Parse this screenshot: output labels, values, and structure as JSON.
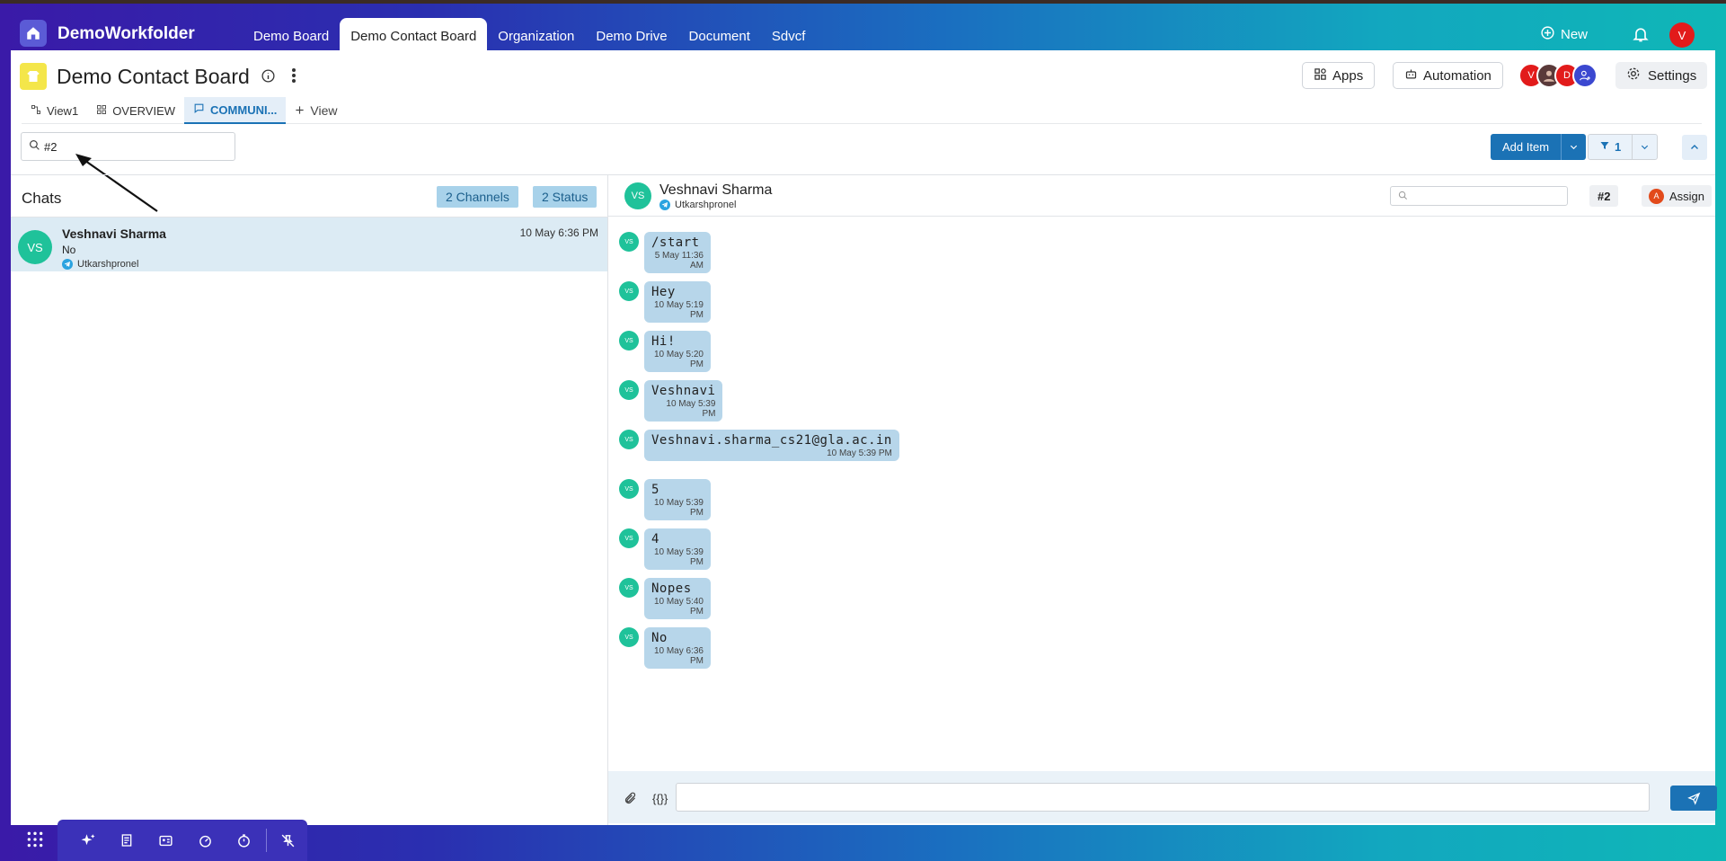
{
  "app": {
    "brand": "DemoWorkfolder",
    "nav_tabs": [
      "Demo Board",
      "Demo Contact Board",
      "Organization",
      "Demo Drive",
      "Document",
      "Sdvcf"
    ],
    "active_tab_index": 1,
    "new_label": "New",
    "user_initial": "V"
  },
  "board": {
    "title": "Demo Contact Board",
    "apps_label": "Apps",
    "automation_label": "Automation",
    "settings_label": "Settings",
    "member_initials": [
      "V",
      "",
      "D",
      ""
    ],
    "views": [
      "View1",
      "OVERVIEW",
      "COMMUNI...",
      "View"
    ],
    "active_view_index": 2
  },
  "toolbar": {
    "search_value": "#2",
    "add_item_label": "Add Item",
    "filter_count": "1"
  },
  "chats": {
    "title": "Chats",
    "channels_chip": "2 Channels",
    "status_chip": "2 Status",
    "items": [
      {
        "initials": "VS",
        "name": "Veshnavi Sharma",
        "time": "10 May 6:36 PM",
        "last": "No",
        "source": "Utkarshpronel"
      }
    ]
  },
  "conversation": {
    "initials": "VS",
    "name": "Veshnavi Sharma",
    "source": "Utkarshpronel",
    "tag": "#2",
    "assign_label": "Assign",
    "assign_initial": "A",
    "messages": [
      {
        "text": "/start",
        "time": "5 May 11:36 AM"
      },
      {
        "text": "Hey",
        "time": "10 May 5:19 PM"
      },
      {
        "text": "Hi!",
        "time": "10 May 5:20 PM"
      },
      {
        "text": "Veshnavi",
        "time": "10 May 5:39 PM"
      },
      {
        "text": "Veshnavi.sharma_cs21@gla.ac.in",
        "time": "10 May 5:39 PM"
      },
      {
        "text": "5",
        "time": "10 May 5:39 PM"
      },
      {
        "text": "4",
        "time": "10 May 5:39 PM"
      },
      {
        "text": "Nopes",
        "time": "10 May 5:40 PM"
      },
      {
        "text": "No",
        "time": "10 May 6:36 PM"
      }
    ],
    "variables_label": "{{}}"
  },
  "colors": {
    "accent": "#1b72b5",
    "avatar_green": "#1fc29a",
    "bubble": "#b7d6ea",
    "board_icon": "#f4e64a"
  },
  "icons": [
    "home-icon",
    "plus-circle-icon",
    "bell-icon",
    "info-icon",
    "kebab-icon",
    "apps-icon",
    "robot-icon",
    "gear-icon",
    "search-icon",
    "filter-icon",
    "chevron-down-icon",
    "chevron-up-icon",
    "telegram-icon",
    "paperclip-icon",
    "send-icon",
    "grid-icon",
    "sparkle-icon"
  ]
}
